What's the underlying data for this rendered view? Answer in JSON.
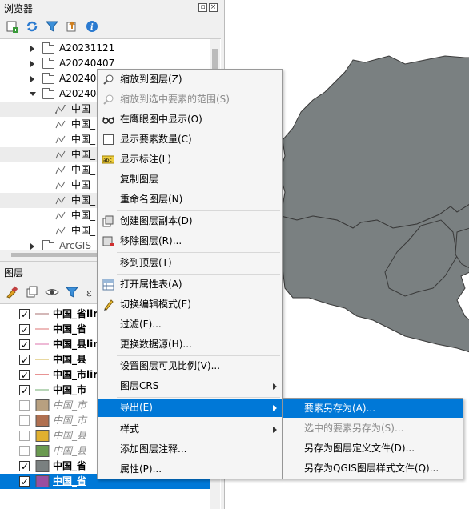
{
  "browser_panel": {
    "title": "浏览器",
    "items": [
      {
        "label": "A20231121"
      },
      {
        "label": "A20240407"
      },
      {
        "label": "A202404"
      },
      {
        "label": "A202404"
      },
      {
        "label": "中国_"
      },
      {
        "label": "中国_"
      },
      {
        "label": "中国_"
      },
      {
        "label": "中国_"
      },
      {
        "label": "中国_"
      },
      {
        "label": "中国_"
      },
      {
        "label": "中国_"
      },
      {
        "label": "中国_"
      },
      {
        "label": "中国_"
      },
      {
        "label": "ArcGIS"
      }
    ]
  },
  "layers_panel": {
    "title": "图层",
    "layers": [
      {
        "label": "中国_省lin",
        "checked": true,
        "style": "bold",
        "color": "#c6a0a0"
      },
      {
        "label": "中国_省",
        "checked": true,
        "style": "bold",
        "color": "#e8a3a3"
      },
      {
        "label": "中国_县lin",
        "checked": true,
        "style": "bold",
        "color": "#e8a3c8"
      },
      {
        "label": "中国_县",
        "checked": true,
        "style": "bold",
        "color": "#e0cc80"
      },
      {
        "label": "中国_市lin",
        "checked": true,
        "style": "bold",
        "color": "#e07070"
      },
      {
        "label": "中国_市",
        "checked": true,
        "style": "bold",
        "color": "#a0c8a0"
      },
      {
        "label": "中国_市",
        "checked": false,
        "style": "italic",
        "color": "#b8a080"
      },
      {
        "label": "中国_市",
        "checked": false,
        "style": "italic",
        "color": "#b07050"
      },
      {
        "label": "中国_县",
        "checked": false,
        "style": "italic",
        "color": "#e0b030"
      },
      {
        "label": "中国_县",
        "checked": false,
        "style": "italic",
        "color": "#6a9a50"
      },
      {
        "label": "中国_省",
        "checked": true,
        "style": "bold",
        "color": "#7a8080"
      },
      {
        "label": "中国_省",
        "checked": true,
        "style": "selected",
        "color": "#9a4fa0"
      }
    ]
  },
  "context_menu": {
    "items": [
      {
        "label": "缩放到图层(Z)",
        "icon": "zoom-layer-icon"
      },
      {
        "label": "缩放到选中要素的范围(S)",
        "icon": "zoom-selection-icon",
        "disabled": true
      },
      {
        "label": "在鹰眼图中显示(O)",
        "icon": "overview-glasses-icon"
      },
      {
        "label": "显示要素数量(C)",
        "icon": "checkbox-icon"
      },
      {
        "label": "显示标注(L)",
        "icon": "label-abc-icon"
      },
      {
        "label": "复制图层",
        "icon": ""
      },
      {
        "label": "重命名图层(N)",
        "icon": ""
      },
      {
        "label": "创建图层副本(D)",
        "icon": "duplicate-layer-icon"
      },
      {
        "label": "移除图层(R)...",
        "icon": "remove-layer-icon"
      },
      {
        "label": "移到顶层(T)",
        "icon": ""
      },
      {
        "label": "打开属性表(A)",
        "icon": "attribute-table-icon"
      },
      {
        "label": "切换编辑模式(E)",
        "icon": "pencil-icon"
      },
      {
        "label": "过滤(F)...",
        "icon": ""
      },
      {
        "label": "更换数据源(H)...",
        "icon": ""
      },
      {
        "label": "设置图层可见比例(V)...",
        "icon": ""
      },
      {
        "label": "图层CRS",
        "icon": ""
      },
      {
        "label": "导出(E)",
        "icon": ""
      },
      {
        "label": "样式",
        "icon": ""
      },
      {
        "label": "添加图层注释...",
        "icon": ""
      },
      {
        "label": "属性(P)...",
        "icon": ""
      }
    ]
  },
  "export_submenu": {
    "items": [
      {
        "label": "要素另存为(A)...",
        "highlighted": true
      },
      {
        "label": "选中的要素另存为(S)...",
        "disabled": true
      },
      {
        "label": "另存为图层定义文件(D)..."
      },
      {
        "label": "另存为QGIS图层样式文件(Q)..."
      }
    ]
  },
  "colors": {
    "accent": "#0078d7",
    "map_fill": "#7a8081",
    "map_stroke": "#3a3a3a"
  }
}
